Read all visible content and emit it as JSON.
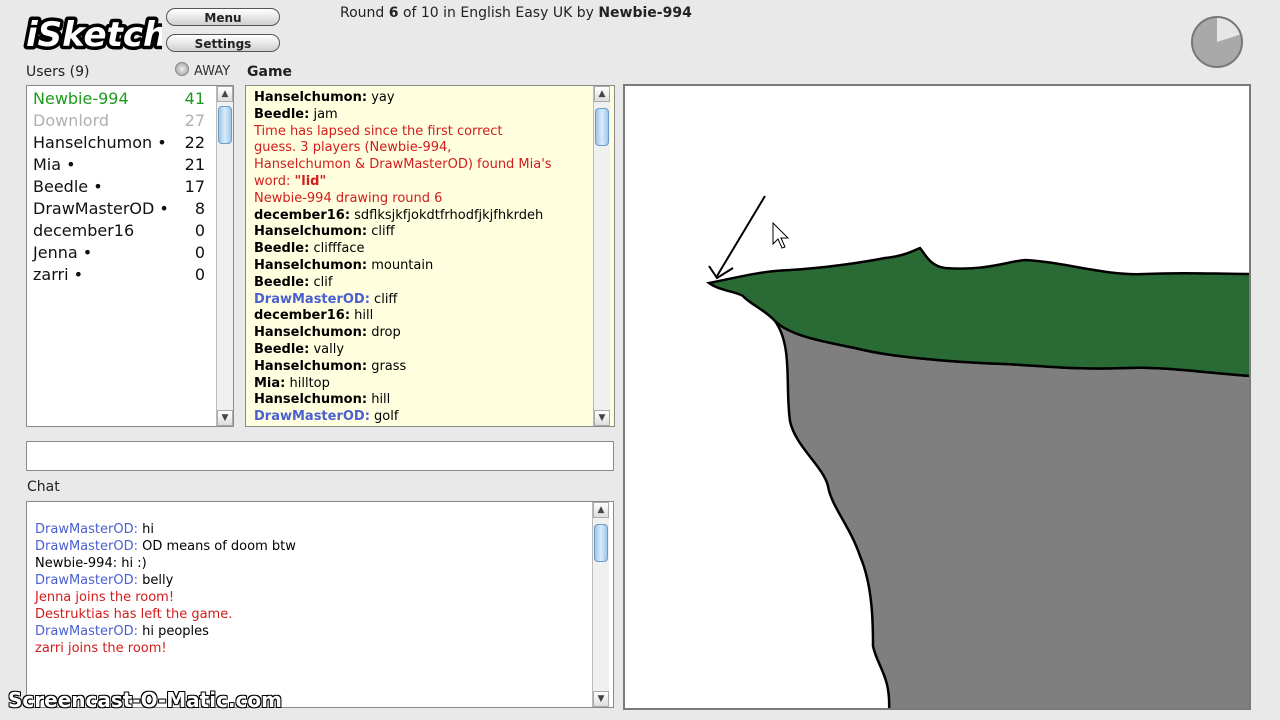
{
  "app": {
    "logo_text": "iSketch",
    "menu_label": "Menu",
    "settings_label": "Settings"
  },
  "header": {
    "round_prefix": "Round ",
    "round_current": "6",
    "round_mid": " of 10 in English Easy UK by ",
    "drawer": "Newbie-994"
  },
  "users": {
    "heading": "Users (9)",
    "away_label": "AWAY",
    "list": [
      {
        "name": "Newbie-994",
        "score": "41",
        "style": "leader"
      },
      {
        "name": "Downlord",
        "score": "27",
        "style": "away"
      },
      {
        "name": "Hanselchumon •",
        "score": "22",
        "style": "normal"
      },
      {
        "name": "Mia •",
        "score": "21",
        "style": "normal"
      },
      {
        "name": "Beedle •",
        "score": "17",
        "style": "normal"
      },
      {
        "name": "DrawMasterOD •",
        "score": "8",
        "style": "normal"
      },
      {
        "name": "december16",
        "score": "0",
        "style": "normal"
      },
      {
        "name": "Jenna •",
        "score": "0",
        "style": "normal"
      },
      {
        "name": "zarri •",
        "score": "0",
        "style": "normal"
      }
    ]
  },
  "game": {
    "heading": "Game",
    "log": [
      {
        "who": "Hanselchumon:",
        "text": " yay",
        "kind": "normal"
      },
      {
        "who": "Beedle:",
        "text": " jam",
        "kind": "normal"
      },
      {
        "who": "",
        "text": "Time has lapsed since the first correct",
        "kind": "system"
      },
      {
        "who": "",
        "text": "guess. 3 players (Newbie-994,",
        "kind": "system"
      },
      {
        "who": "",
        "text": "Hanselchumon & DrawMasterOD) found Mia's",
        "kind": "system"
      },
      {
        "who": "",
        "text": "word: ",
        "word": "\"lid\"",
        "kind": "system-word"
      },
      {
        "who": "",
        "text": "Newbie-994 drawing round 6",
        "kind": "system"
      },
      {
        "who": "december16:",
        "text": " sdflksjkfjokdtfrhodfjkjfhkrdeh",
        "kind": "normal"
      },
      {
        "who": "Hanselchumon:",
        "text": " cliff",
        "kind": "normal"
      },
      {
        "who": "Beedle:",
        "text": " cliffface",
        "kind": "normal"
      },
      {
        "who": "Hanselchumon:",
        "text": " mountain",
        "kind": "normal"
      },
      {
        "who": "Beedle:",
        "text": " clif",
        "kind": "normal"
      },
      {
        "who": "DrawMasterOD:",
        "text": " cliff",
        "kind": "blue"
      },
      {
        "who": "december16:",
        "text": " hill",
        "kind": "normal"
      },
      {
        "who": "Hanselchumon:",
        "text": " drop",
        "kind": "normal"
      },
      {
        "who": "Beedle:",
        "text": " vally",
        "kind": "normal"
      },
      {
        "who": "Hanselchumon:",
        "text": " grass",
        "kind": "normal"
      },
      {
        "who": "Mia:",
        "text": " hilltop",
        "kind": "normal"
      },
      {
        "who": "Hanselchumon:",
        "text": " hill",
        "kind": "normal"
      },
      {
        "who": "DrawMasterOD:",
        "text": " golf",
        "kind": "blue"
      }
    ]
  },
  "guess_input": {
    "value": ""
  },
  "chat": {
    "heading": "Chat",
    "log": [
      {
        "who": "DrawMasterOD:",
        "text": " hi",
        "kind": "blue"
      },
      {
        "who": "DrawMasterOD:",
        "text": " OD means of doom btw",
        "kind": "blue"
      },
      {
        "who": "Newbie-994:",
        "text": " hi :)",
        "kind": "normal"
      },
      {
        "who": "DrawMasterOD:",
        "text": " belly",
        "kind": "blue"
      },
      {
        "who": "",
        "text": "Jenna joins the room!",
        "kind": "system"
      },
      {
        "who": "",
        "text": "Destruktias has left the game.",
        "kind": "system"
      },
      {
        "who": "DrawMasterOD:",
        "text": " hi peoples",
        "kind": "blue"
      },
      {
        "who": "",
        "text": "zarri joins the room!",
        "kind": "system"
      }
    ]
  },
  "timer": {
    "elapsed_fraction": 0.2
  },
  "watermark": "Screencast-O-Matic.com",
  "colors": {
    "leader": "#1e9a1e",
    "away": "#b0b0b0",
    "blue_name": "#4a5fd0",
    "system": "#d21c1c",
    "game_bg": "#ffffe0",
    "grass": "#2a6b35",
    "rock": "#7f7f7f"
  }
}
